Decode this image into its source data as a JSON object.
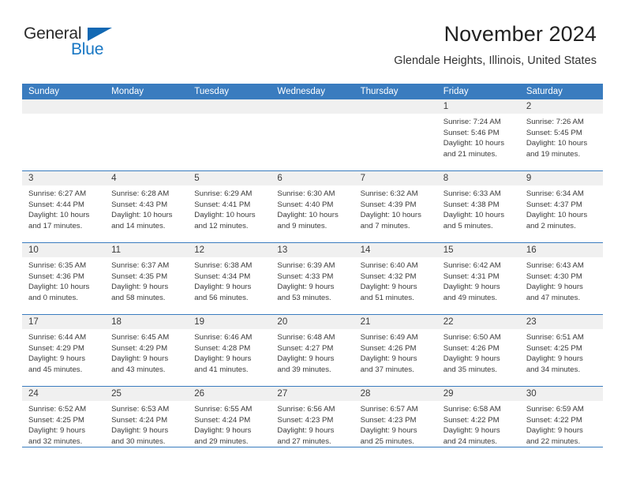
{
  "brand": {
    "name_part1": "General",
    "name_part2": "Blue",
    "triangle_icon": "blue-triangle-icon",
    "color_dark": "#2b2b2b",
    "color_blue": "#1877c4"
  },
  "header": {
    "title": "November 2024",
    "subtitle": "Glendale Heights, Illinois, United States"
  },
  "theme": {
    "header_bar": "#3a7cbf",
    "day_band": "#f0f0f0",
    "text": "#3a3a3a"
  },
  "weekdays": [
    "Sunday",
    "Monday",
    "Tuesday",
    "Wednesday",
    "Thursday",
    "Friday",
    "Saturday"
  ],
  "labels": {
    "sunrise": "Sunrise:",
    "sunset": "Sunset:",
    "daylight": "Daylight:"
  },
  "weeks": [
    [
      {
        "day": "",
        "sunrise": "",
        "sunset": "",
        "daylight_line1": "",
        "daylight_line2": ""
      },
      {
        "day": "",
        "sunrise": "",
        "sunset": "",
        "daylight_line1": "",
        "daylight_line2": ""
      },
      {
        "day": "",
        "sunrise": "",
        "sunset": "",
        "daylight_line1": "",
        "daylight_line2": ""
      },
      {
        "day": "",
        "sunrise": "",
        "sunset": "",
        "daylight_line1": "",
        "daylight_line2": ""
      },
      {
        "day": "",
        "sunrise": "",
        "sunset": "",
        "daylight_line1": "",
        "daylight_line2": ""
      },
      {
        "day": "1",
        "sunrise": "Sunrise: 7:24 AM",
        "sunset": "Sunset: 5:46 PM",
        "daylight_line1": "Daylight: 10 hours",
        "daylight_line2": "and 21 minutes."
      },
      {
        "day": "2",
        "sunrise": "Sunrise: 7:26 AM",
        "sunset": "Sunset: 5:45 PM",
        "daylight_line1": "Daylight: 10 hours",
        "daylight_line2": "and 19 minutes."
      }
    ],
    [
      {
        "day": "3",
        "sunrise": "Sunrise: 6:27 AM",
        "sunset": "Sunset: 4:44 PM",
        "daylight_line1": "Daylight: 10 hours",
        "daylight_line2": "and 17 minutes."
      },
      {
        "day": "4",
        "sunrise": "Sunrise: 6:28 AM",
        "sunset": "Sunset: 4:43 PM",
        "daylight_line1": "Daylight: 10 hours",
        "daylight_line2": "and 14 minutes."
      },
      {
        "day": "5",
        "sunrise": "Sunrise: 6:29 AM",
        "sunset": "Sunset: 4:41 PM",
        "daylight_line1": "Daylight: 10 hours",
        "daylight_line2": "and 12 minutes."
      },
      {
        "day": "6",
        "sunrise": "Sunrise: 6:30 AM",
        "sunset": "Sunset: 4:40 PM",
        "daylight_line1": "Daylight: 10 hours",
        "daylight_line2": "and 9 minutes."
      },
      {
        "day": "7",
        "sunrise": "Sunrise: 6:32 AM",
        "sunset": "Sunset: 4:39 PM",
        "daylight_line1": "Daylight: 10 hours",
        "daylight_line2": "and 7 minutes."
      },
      {
        "day": "8",
        "sunrise": "Sunrise: 6:33 AM",
        "sunset": "Sunset: 4:38 PM",
        "daylight_line1": "Daylight: 10 hours",
        "daylight_line2": "and 5 minutes."
      },
      {
        "day": "9",
        "sunrise": "Sunrise: 6:34 AM",
        "sunset": "Sunset: 4:37 PM",
        "daylight_line1": "Daylight: 10 hours",
        "daylight_line2": "and 2 minutes."
      }
    ],
    [
      {
        "day": "10",
        "sunrise": "Sunrise: 6:35 AM",
        "sunset": "Sunset: 4:36 PM",
        "daylight_line1": "Daylight: 10 hours",
        "daylight_line2": "and 0 minutes."
      },
      {
        "day": "11",
        "sunrise": "Sunrise: 6:37 AM",
        "sunset": "Sunset: 4:35 PM",
        "daylight_line1": "Daylight: 9 hours",
        "daylight_line2": "and 58 minutes."
      },
      {
        "day": "12",
        "sunrise": "Sunrise: 6:38 AM",
        "sunset": "Sunset: 4:34 PM",
        "daylight_line1": "Daylight: 9 hours",
        "daylight_line2": "and 56 minutes."
      },
      {
        "day": "13",
        "sunrise": "Sunrise: 6:39 AM",
        "sunset": "Sunset: 4:33 PM",
        "daylight_line1": "Daylight: 9 hours",
        "daylight_line2": "and 53 minutes."
      },
      {
        "day": "14",
        "sunrise": "Sunrise: 6:40 AM",
        "sunset": "Sunset: 4:32 PM",
        "daylight_line1": "Daylight: 9 hours",
        "daylight_line2": "and 51 minutes."
      },
      {
        "day": "15",
        "sunrise": "Sunrise: 6:42 AM",
        "sunset": "Sunset: 4:31 PM",
        "daylight_line1": "Daylight: 9 hours",
        "daylight_line2": "and 49 minutes."
      },
      {
        "day": "16",
        "sunrise": "Sunrise: 6:43 AM",
        "sunset": "Sunset: 4:30 PM",
        "daylight_line1": "Daylight: 9 hours",
        "daylight_line2": "and 47 minutes."
      }
    ],
    [
      {
        "day": "17",
        "sunrise": "Sunrise: 6:44 AM",
        "sunset": "Sunset: 4:29 PM",
        "daylight_line1": "Daylight: 9 hours",
        "daylight_line2": "and 45 minutes."
      },
      {
        "day": "18",
        "sunrise": "Sunrise: 6:45 AM",
        "sunset": "Sunset: 4:29 PM",
        "daylight_line1": "Daylight: 9 hours",
        "daylight_line2": "and 43 minutes."
      },
      {
        "day": "19",
        "sunrise": "Sunrise: 6:46 AM",
        "sunset": "Sunset: 4:28 PM",
        "daylight_line1": "Daylight: 9 hours",
        "daylight_line2": "and 41 minutes."
      },
      {
        "day": "20",
        "sunrise": "Sunrise: 6:48 AM",
        "sunset": "Sunset: 4:27 PM",
        "daylight_line1": "Daylight: 9 hours",
        "daylight_line2": "and 39 minutes."
      },
      {
        "day": "21",
        "sunrise": "Sunrise: 6:49 AM",
        "sunset": "Sunset: 4:26 PM",
        "daylight_line1": "Daylight: 9 hours",
        "daylight_line2": "and 37 minutes."
      },
      {
        "day": "22",
        "sunrise": "Sunrise: 6:50 AM",
        "sunset": "Sunset: 4:26 PM",
        "daylight_line1": "Daylight: 9 hours",
        "daylight_line2": "and 35 minutes."
      },
      {
        "day": "23",
        "sunrise": "Sunrise: 6:51 AM",
        "sunset": "Sunset: 4:25 PM",
        "daylight_line1": "Daylight: 9 hours",
        "daylight_line2": "and 34 minutes."
      }
    ],
    [
      {
        "day": "24",
        "sunrise": "Sunrise: 6:52 AM",
        "sunset": "Sunset: 4:25 PM",
        "daylight_line1": "Daylight: 9 hours",
        "daylight_line2": "and 32 minutes."
      },
      {
        "day": "25",
        "sunrise": "Sunrise: 6:53 AM",
        "sunset": "Sunset: 4:24 PM",
        "daylight_line1": "Daylight: 9 hours",
        "daylight_line2": "and 30 minutes."
      },
      {
        "day": "26",
        "sunrise": "Sunrise: 6:55 AM",
        "sunset": "Sunset: 4:24 PM",
        "daylight_line1": "Daylight: 9 hours",
        "daylight_line2": "and 29 minutes."
      },
      {
        "day": "27",
        "sunrise": "Sunrise: 6:56 AM",
        "sunset": "Sunset: 4:23 PM",
        "daylight_line1": "Daylight: 9 hours",
        "daylight_line2": "and 27 minutes."
      },
      {
        "day": "28",
        "sunrise": "Sunrise: 6:57 AM",
        "sunset": "Sunset: 4:23 PM",
        "daylight_line1": "Daylight: 9 hours",
        "daylight_line2": "and 25 minutes."
      },
      {
        "day": "29",
        "sunrise": "Sunrise: 6:58 AM",
        "sunset": "Sunset: 4:22 PM",
        "daylight_line1": "Daylight: 9 hours",
        "daylight_line2": "and 24 minutes."
      },
      {
        "day": "30",
        "sunrise": "Sunrise: 6:59 AM",
        "sunset": "Sunset: 4:22 PM",
        "daylight_line1": "Daylight: 9 hours",
        "daylight_line2": "and 22 minutes."
      }
    ]
  ]
}
